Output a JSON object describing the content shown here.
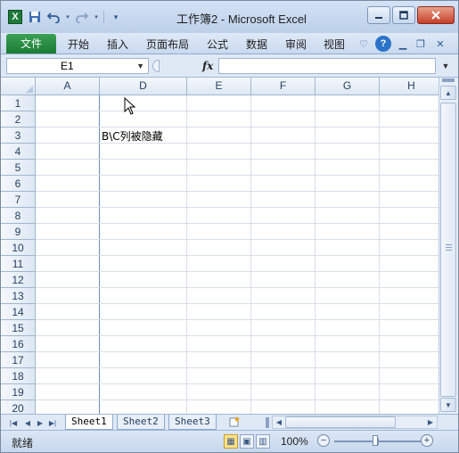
{
  "titlebar": {
    "app_icon": "excel-logo",
    "title": "工作簿2 - Microsoft Excel",
    "qat_icons": [
      "save-icon",
      "undo-icon",
      "redo-icon",
      "customize-icon"
    ]
  },
  "ribbon": {
    "file_tab": "文件",
    "tabs": [
      "开始",
      "插入",
      "页面布局",
      "公式",
      "数据",
      "审阅",
      "视图"
    ]
  },
  "formula_bar": {
    "name_box": "E1",
    "fx_label": "fx",
    "formula_value": ""
  },
  "sheet": {
    "columns": [
      "A",
      "D",
      "E",
      "F",
      "G",
      "H"
    ],
    "rows": [
      "1",
      "2",
      "3",
      "4",
      "5",
      "6",
      "7",
      "8",
      "9",
      "10",
      "11",
      "12",
      "13",
      "14",
      "15",
      "16",
      "17",
      "18",
      "19",
      "20"
    ],
    "cells": [
      {
        "ref": "D3",
        "value": "B\\C列被隐藏"
      }
    ]
  },
  "sheet_tabs": {
    "tabs": [
      "Sheet1",
      "Sheet2",
      "Sheet3"
    ],
    "active": "Sheet1"
  },
  "statusbar": {
    "status": "就绪",
    "zoom": "100%",
    "zoom_out": "−",
    "zoom_in": "+"
  }
}
